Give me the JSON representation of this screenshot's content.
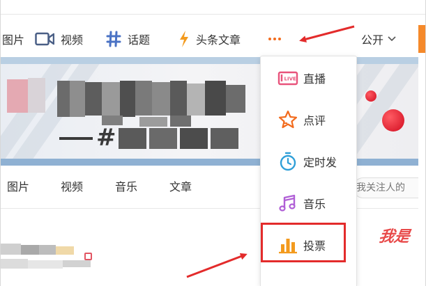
{
  "toolbar": {
    "items": [
      {
        "label": "图片",
        "icon": "image-icon"
      },
      {
        "label": "视频",
        "icon": "video-icon"
      },
      {
        "label": "话题",
        "icon": "hashtag-icon"
      },
      {
        "label": "头条文章",
        "icon": "lightning-icon"
      }
    ],
    "more_icon": "more-dots-icon",
    "visibility_label": "公开",
    "accent_color": "#f26b1d"
  },
  "banner": {
    "hash_text": "#"
  },
  "tabs": [
    "图片",
    "视频",
    "音乐",
    "文章"
  ],
  "search": {
    "placeholder": "我关注人的"
  },
  "feed": {
    "red_text": "我是"
  },
  "dropdown": {
    "items": [
      {
        "label": "直播",
        "icon": "live-icon",
        "color": "#e8537b"
      },
      {
        "label": "点评",
        "icon": "star-icon",
        "color": "#f26b1d"
      },
      {
        "label": "定时发",
        "icon": "timer-icon",
        "color": "#2f9fd8"
      },
      {
        "label": "音乐",
        "icon": "music-icon",
        "color": "#b05fd6"
      },
      {
        "label": "投票",
        "icon": "bar-chart-icon",
        "color": "#f39a1d"
      }
    ],
    "highlighted": "投票"
  },
  "annotation_color": "#e32b2b"
}
